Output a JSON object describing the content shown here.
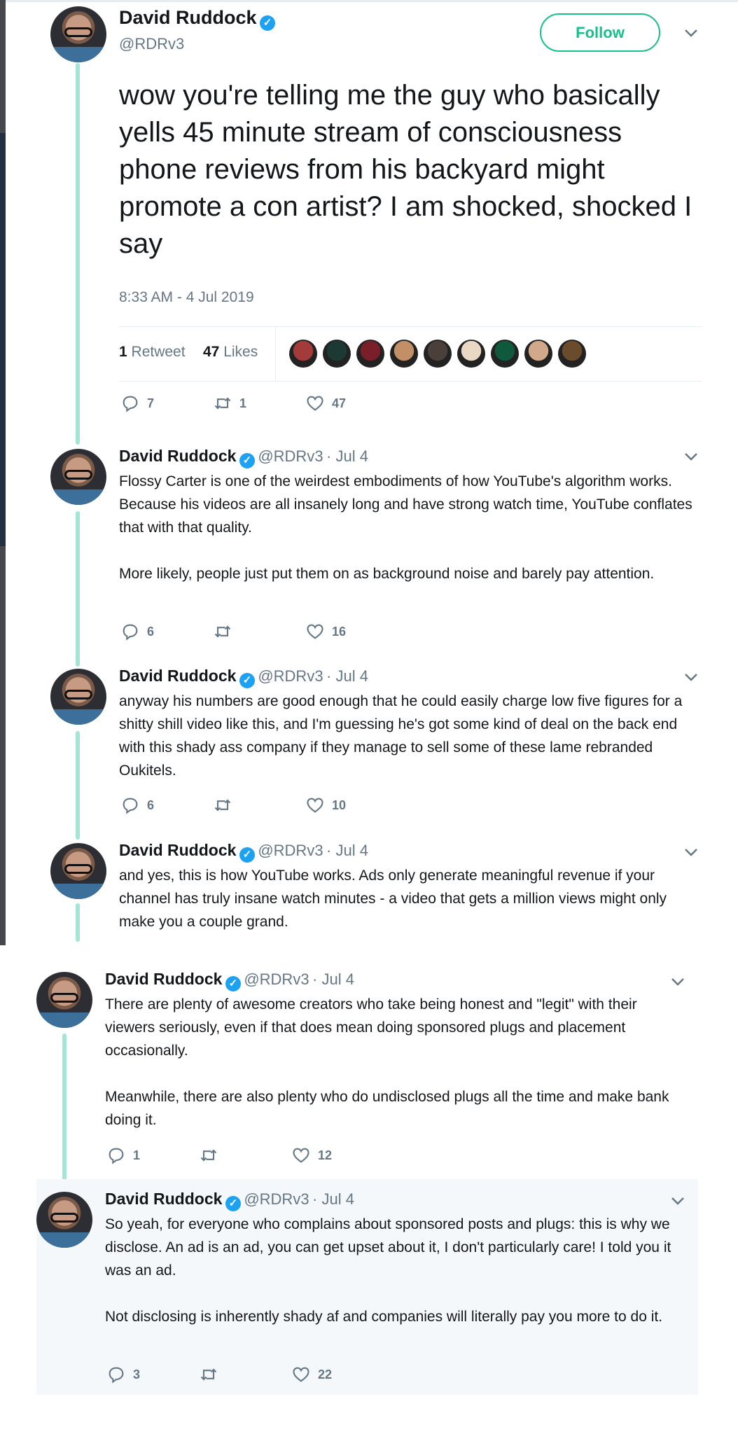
{
  "main_tweet": {
    "name": "David Ruddock",
    "handle": "@RDRv3",
    "follow_label": "Follow",
    "text": "wow you're telling me the guy who basically yells 45 minute stream of consciousness phone reviews from his backyard might promote a con artist? I am shocked, shocked I say",
    "timestamp": "8:33 AM - 4 Jul 2019",
    "retweets_count": "1",
    "retweets_label": "Retweet",
    "likes_count": "47",
    "likes_label": "Likes",
    "reply_count": "7",
    "retweet_count": "1",
    "like_count": "47",
    "liker_avatar_colors": [
      "#a33b3b",
      "#1c3a33",
      "#7a1f2a",
      "#c28f66",
      "#4a3f3b",
      "#e8d8c4",
      "#0f5a3c",
      "#d1a98a",
      "#6a4b2b"
    ]
  },
  "replies": [
    {
      "name": "David Ruddock",
      "handle": "@RDRv3",
      "date": "· Jul 4",
      "text": "Flossy Carter is one of the weirdest embodiments of how YouTube's algorithm works. Because his videos are all insanely long and have strong watch time, YouTube conflates that with that quality.\n\nMore likely, people just put them on as background noise and barely pay attention.",
      "reply_count": "6",
      "retweet_count": "",
      "like_count": "16"
    },
    {
      "name": "David Ruddock",
      "handle": "@RDRv3",
      "date": "· Jul 4",
      "text": "anyway his numbers are good enough that he could easily charge low five figures for a shitty shill video like this, and I'm guessing he's got some kind of deal on the back end with this shady ass company if they manage to sell some of these lame rebranded Oukitels.",
      "reply_count": "6",
      "retweet_count": "",
      "like_count": "10"
    },
    {
      "name": "David Ruddock",
      "handle": "@RDRv3",
      "date": "· Jul 4",
      "text": "and yes, this is how YouTube works. Ads only generate meaningful revenue if your channel has truly insane watch minutes - a video that gets a million views might only make you a couple grand."
    },
    {
      "name": "David Ruddock",
      "handle": "@RDRv3",
      "date": "· Jul 4",
      "text": "There are plenty of awesome creators who take being honest and \"legit\" with their viewers seriously, even if that does mean doing sponsored plugs and placement occasionally.\n\nMeanwhile, there are also plenty who do undisclosed plugs all the time and make bank doing it.",
      "reply_count": "1",
      "retweet_count": "",
      "like_count": "12"
    },
    {
      "name": "David Ruddock",
      "handle": "@RDRv3",
      "date": "· Jul 4",
      "text": "So yeah, for everyone who complains about sponsored posts and plugs: this is why we disclose. An ad is an ad, you can get upset about it, I don't particularly care! I told you it was an ad.\n\nNot disclosing is inherently shady af and companies will literally pay you more to do it.",
      "reply_count": "3",
      "retweet_count": "",
      "like_count": "22"
    }
  ],
  "verified_glyph": "✓",
  "colors": {
    "follow": "#17bf8a",
    "thread_line": "#a3e6d6",
    "verified": "#1da1f2",
    "secondary_text": "#657786"
  }
}
